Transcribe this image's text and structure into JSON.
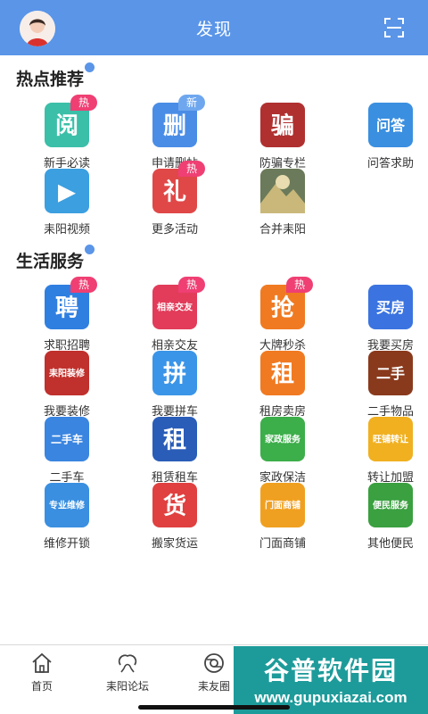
{
  "header": {
    "title": "发现"
  },
  "sections": [
    {
      "title": "热点推荐",
      "items": [
        {
          "label": "新手必读",
          "badge": "热",
          "icon_glyph": "阅",
          "color": "#3bbfa8",
          "icon": "book-icon"
        },
        {
          "label": "申请删帖",
          "badge": "新",
          "icon_glyph": "删",
          "color": "#4a8de6",
          "icon": "delete-post-icon"
        },
        {
          "label": "防骗专栏",
          "badge": "",
          "icon_glyph": "骗",
          "color": "#b03030",
          "icon": "anti-fraud-icon"
        },
        {
          "label": "问答求助",
          "badge": "",
          "icon_glyph": "问答",
          "color": "#3a8fe0",
          "icon": "qa-icon"
        },
        {
          "label": "耒阳视频",
          "badge": "",
          "icon_glyph": "▶",
          "color": "#3b9fe0",
          "icon": "video-icon"
        },
        {
          "label": "更多活动",
          "badge": "热",
          "icon_glyph": "礼",
          "color": "#e04848",
          "icon": "gift-icon"
        },
        {
          "label": "合并耒阳",
          "badge": "",
          "icon_glyph": "",
          "color": "#6b7a5a",
          "icon": "photo-icon"
        }
      ]
    },
    {
      "title": "生活服务",
      "items": [
        {
          "label": "求职招聘",
          "badge": "热",
          "icon_glyph": "聘",
          "color": "#2f7fe0",
          "icon": "job-icon"
        },
        {
          "label": "相亲交友",
          "badge": "热",
          "icon_glyph": "相亲交友",
          "color": "#e23c5a",
          "icon": "dating-icon"
        },
        {
          "label": "大牌秒杀",
          "badge": "热",
          "icon_glyph": "抢",
          "color": "#f07a22",
          "icon": "flash-sale-icon"
        },
        {
          "label": "我要买房",
          "badge": "",
          "icon_glyph": "买房",
          "color": "#3b74e0",
          "icon": "buy-house-icon"
        },
        {
          "label": "我要装修",
          "badge": "",
          "icon_glyph": "耒阳装修",
          "color": "#c0302c",
          "icon": "renovation-icon"
        },
        {
          "label": "我要拼车",
          "badge": "",
          "icon_glyph": "拼",
          "color": "#3a95e8",
          "icon": "carpool-icon"
        },
        {
          "label": "租房卖房",
          "badge": "",
          "icon_glyph": "租",
          "color": "#f07a22",
          "icon": "rent-icon"
        },
        {
          "label": "二手物品",
          "badge": "",
          "icon_glyph": "二手",
          "color": "#8a3a1c",
          "icon": "secondhand-icon"
        },
        {
          "label": "二手车",
          "badge": "",
          "icon_glyph": "二手车",
          "color": "#3a85e0",
          "icon": "used-car-icon"
        },
        {
          "label": "租赁租车",
          "badge": "",
          "icon_glyph": "租",
          "color": "#2a5db8",
          "icon": "truck-rental-icon"
        },
        {
          "label": "家政保洁",
          "badge": "",
          "icon_glyph": "家政服务",
          "color": "#3cae4a",
          "icon": "housekeeping-icon"
        },
        {
          "label": "转让加盟",
          "badge": "",
          "icon_glyph": "旺铺转让",
          "color": "#f0b020",
          "icon": "transfer-icon"
        },
        {
          "label": "维修开锁",
          "badge": "",
          "icon_glyph": "专业维修",
          "color": "#3a8fe0",
          "icon": "repair-icon"
        },
        {
          "label": "搬家货运",
          "badge": "",
          "icon_glyph": "货",
          "color": "#e04040",
          "icon": "moving-icon"
        },
        {
          "label": "门面商铺",
          "badge": "",
          "icon_glyph": "门面商铺",
          "color": "#f0a020",
          "icon": "shop-icon"
        },
        {
          "label": "其他便民",
          "badge": "",
          "icon_glyph": "便民服务",
          "color": "#3aa040",
          "icon": "convenience-icon"
        }
      ]
    }
  ],
  "tabbar": [
    {
      "label": "首页",
      "icon": "home-icon"
    },
    {
      "label": "耒阳论坛",
      "icon": "forum-icon"
    },
    {
      "label": "耒友圈",
      "icon": "circle-icon"
    }
  ],
  "watermark": {
    "top": "谷普软件园",
    "bottom": "www.gupuxiazai.com"
  }
}
